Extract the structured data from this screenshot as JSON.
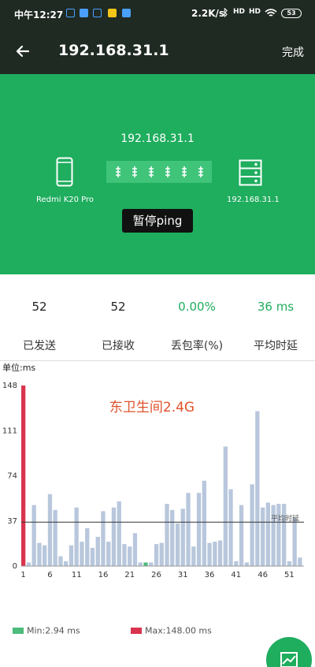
{
  "status": {
    "time": "中午12:27",
    "speed": "2.2K/s",
    "signal1": "HD",
    "signal2": "HD",
    "battery": "53"
  },
  "appbar": {
    "title": "192.168.31.1",
    "done": "完成"
  },
  "panel": {
    "target_ip": "192.168.31.1",
    "device_name": "Redmi K20 Pro",
    "dest_ip": "192.168.31.1",
    "pause_label": "暂停ping"
  },
  "stats": {
    "sent": "52",
    "received": "52",
    "loss": "0.00%",
    "avg": "36 ms",
    "sent_label": "已发送",
    "received_label": "已接收",
    "loss_label": "丢包率(%)",
    "avg_label": "平均时延"
  },
  "chart_data": {
    "type": "bar",
    "unit_label": "单位:ms",
    "watermark": "东卫生间2.4G",
    "avg_label": "平均时延",
    "avg_value": 36,
    "ylim": [
      0,
      148
    ],
    "yticks": [
      0,
      37,
      74,
      111,
      148
    ],
    "xticks": [
      1,
      6,
      11,
      16,
      21,
      26,
      31,
      36,
      41,
      46,
      51
    ],
    "values": [
      148,
      3,
      50,
      19,
      17,
      59,
      46,
      8,
      4,
      17,
      48,
      20,
      31,
      15,
      24,
      45,
      20,
      48,
      53,
      18,
      16,
      27,
      3,
      2.94,
      3,
      18,
      19,
      51,
      46,
      35,
      47,
      60,
      16,
      60,
      70,
      19,
      20,
      21,
      98,
      63,
      4,
      50,
      3,
      67,
      127,
      48,
      52,
      50,
      51,
      51,
      4,
      40,
      7
    ],
    "max_index": 0,
    "min_index": 23,
    "colors": {
      "bar": "#b8c7dc",
      "max": "#d9344f",
      "min": "#4cbb7b"
    },
    "legend": [
      {
        "label": "Min:2.94 ms",
        "color": "#4cbb7b"
      },
      {
        "label": "Max:148.00 ms",
        "color": "#d9344f"
      }
    ]
  }
}
